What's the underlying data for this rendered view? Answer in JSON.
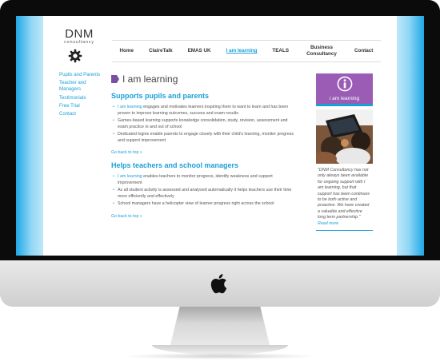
{
  "logo": {
    "name": "DNM",
    "subtitle": "consultancy"
  },
  "nav": {
    "items": [
      {
        "label": "Home"
      },
      {
        "label": "ClaireTalk"
      },
      {
        "label": "EMAS UK"
      },
      {
        "label": "I am learning"
      },
      {
        "label": "TEALS"
      },
      {
        "label": "Business Consultancy"
      },
      {
        "label": "Contact"
      }
    ],
    "active": "I am learning"
  },
  "sidebar": {
    "items": [
      {
        "label": "Pupils and Parents"
      },
      {
        "label": "Teacher and Managers"
      },
      {
        "label": "Testimonials"
      },
      {
        "label": "Free Trial"
      },
      {
        "label": "Contact"
      }
    ]
  },
  "main": {
    "title": "I am learning",
    "sections": [
      {
        "heading": "Supports pupils and parents",
        "bullets": [
          {
            "highlight": "I am learning",
            "text": " engages and motivates learners inspiring them to want to learn and has been proven to improve learning outcomes, success and exam results"
          },
          {
            "highlight": "",
            "text": "Games-based learning supports knowledge consolidation, study, revision, assessment and exam practice in and out of school"
          },
          {
            "highlight": "",
            "text": "Dedicated logins enable parents to engage closely with their child's learning, monitor progress and support improvement"
          }
        ],
        "back_link": "Go back to top »"
      },
      {
        "heading": "Helps teachers and school managers",
        "bullets": [
          {
            "highlight": "I am learning",
            "text": " enables teachers to monitor progress, identify weakness and support improvement"
          },
          {
            "highlight": "",
            "text": "As all student activity is assessed and analysed automatically it helps teachers use their time more efficiently and effectively"
          },
          {
            "highlight": "",
            "text": "School managers have a helicopter view of learner progress right across the school"
          }
        ],
        "back_link": "Go back to top »"
      }
    ]
  },
  "right_column": {
    "badge_label": "i am learning",
    "quote": "\"DNM Consultancy has not only always been available for ongoing support with I am learning, but that support has been continues to be both active and proactive. We have created a valuable and effective long term partnership.\"",
    "read_more": "Read more"
  },
  "colors": {
    "accent": "#1aa0d8",
    "purple": "#9a5cb5",
    "bezel": "#0b0b0b"
  }
}
